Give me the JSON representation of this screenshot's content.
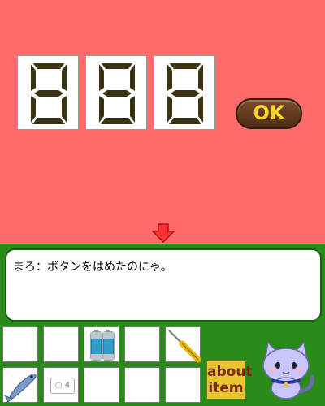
{
  "lock": {
    "digits": [
      "8",
      "8",
      "8"
    ],
    "ok_label": "OK"
  },
  "dialog": {
    "text": "まろ：ボタンをはめたのにゃ。"
  },
  "inventory": {
    "slots": [
      {
        "icon": "empty"
      },
      {
        "icon": "empty"
      },
      {
        "icon": "batteries-icon"
      },
      {
        "icon": "empty"
      },
      {
        "icon": "screwdriver-icon"
      },
      {
        "icon": "fish-icon"
      },
      {
        "icon": "button-tile-icon",
        "label": "○ 4"
      },
      {
        "icon": "empty"
      },
      {
        "icon": "empty"
      },
      {
        "icon": "empty"
      }
    ]
  },
  "about": {
    "line1": "about",
    "line2": "item"
  },
  "colors": {
    "scene_bg": "#ff6b6b",
    "panel_bg": "#2a8a1a",
    "digit_segment": "#3a3412",
    "ok_text": "#f7d42a",
    "about_bg": "#e9c62c"
  }
}
